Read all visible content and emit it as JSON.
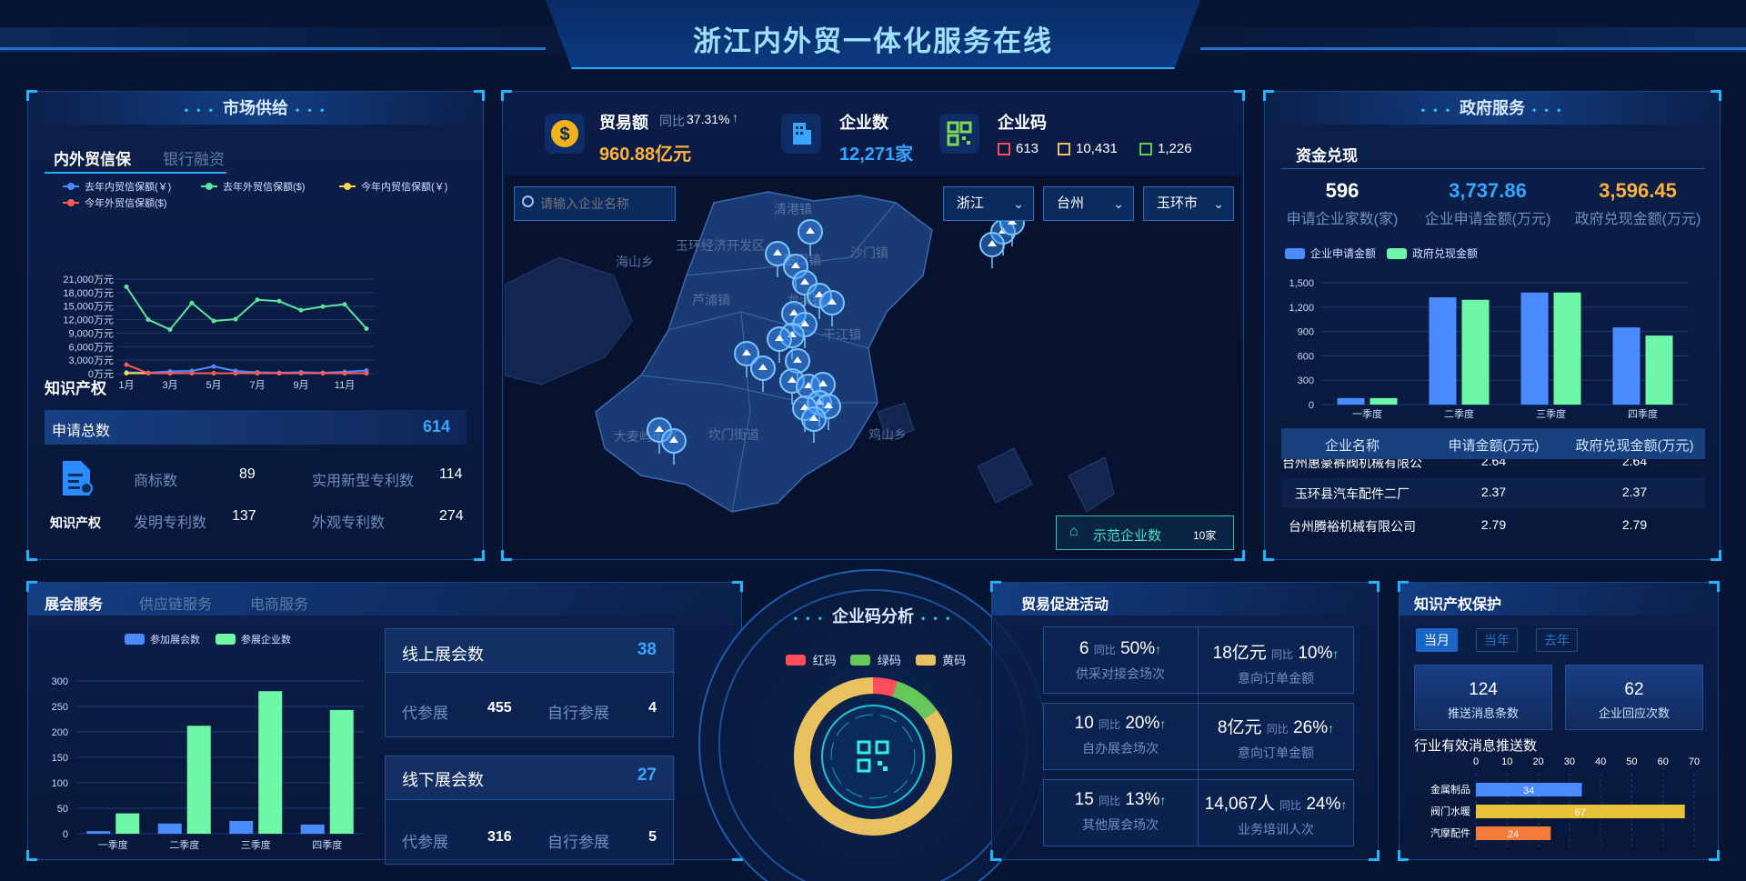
{
  "header": {
    "title": "浙江内外贸一体化服务在线"
  },
  "market": {
    "title": "市场供给",
    "tabs": [
      "内外贸信保",
      "银行融资"
    ],
    "legend": [
      "去年内贸信保额(￥)",
      "去年外贸信保额($)",
      "今年内贸信保额(￥)",
      "今年外贸信保额($)"
    ],
    "legend_colors": [
      "#4a8cff",
      "#5ce39c",
      "#ffd84a",
      "#ff5a5a"
    ],
    "ip_title": "知识产权",
    "apply_total_label": "申请总数",
    "apply_total_value": "614",
    "ip_icon_label": "知识产权",
    "stats": [
      {
        "label": "商标数",
        "value": "89"
      },
      {
        "label": "实用新型专利数",
        "value": "114"
      },
      {
        "label": "发明专利数",
        "value": "137"
      },
      {
        "label": "外观专利数",
        "value": "274"
      }
    ]
  },
  "chart_data": [
    {
      "type": "line",
      "title": "",
      "x": [
        "1月",
        "2月",
        "3月",
        "4月",
        "5月",
        "6月",
        "7月",
        "8月",
        "9月",
        "10月",
        "11月",
        "12月"
      ],
      "x_tick_labels": [
        "1月",
        "3月",
        "5月",
        "7月",
        "9月",
        "11月"
      ],
      "y_tick_labels": [
        "0万元",
        "3,000万元",
        "6,000万元",
        "9,000万元",
        "12,000万元",
        "15,000万元",
        "18,000万元",
        "21,000万元"
      ],
      "ylim": [
        0,
        21000
      ],
      "series": [
        {
          "name": "去年内贸信保额(￥)",
          "color": "#4a8cff",
          "values": [
            300,
            200,
            500,
            600,
            1600,
            600,
            300,
            200,
            300,
            200,
            400,
            700
          ]
        },
        {
          "name": "去年外贸信保额($)",
          "color": "#5ce39c",
          "values": [
            19300,
            12000,
            9800,
            15700,
            11700,
            12100,
            16400,
            16100,
            14100,
            14900,
            15400,
            10000
          ]
        },
        {
          "name": "今年内贸信保额(￥)",
          "color": "#ffd84a",
          "values": [
            100,
            100,
            100,
            100,
            100,
            100,
            100,
            100,
            100,
            100,
            100,
            100
          ]
        },
        {
          "name": "今年外贸信保额($)",
          "color": "#ff5a5a",
          "values": [
            2000,
            100,
            100,
            100,
            100,
            100,
            100,
            100,
            100,
            100,
            100,
            100
          ]
        }
      ]
    },
    {
      "type": "bar",
      "title": "",
      "categories": [
        "一季度",
        "二季度",
        "三季度",
        "四季度"
      ],
      "y_tick_labels": [
        "0",
        "300",
        "600",
        "900",
        "1,200",
        "1,500"
      ],
      "ylim": [
        0,
        1500
      ],
      "series": [
        {
          "name": "企业申请金额",
          "color": "#4a8cff",
          "values": [
            80,
            1320,
            1380,
            950
          ]
        },
        {
          "name": "政府兑现金额",
          "color": "#6df7a6",
          "values": [
            80,
            1290,
            1380,
            850
          ]
        }
      ]
    },
    {
      "type": "bar",
      "title": "",
      "categories": [
        "一季度",
        "二季度",
        "三季度",
        "四季度"
      ],
      "y_tick_labels": [
        "0",
        "50",
        "100",
        "150",
        "200",
        "250",
        "300"
      ],
      "ylim": [
        0,
        300
      ],
      "series": [
        {
          "name": "参加展会数",
          "color": "#4a8cff",
          "values": [
            5,
            20,
            25,
            18
          ]
        },
        {
          "name": "参展企业数",
          "color": "#6df7a6",
          "values": [
            40,
            212,
            280,
            243
          ]
        }
      ]
    },
    {
      "type": "pie",
      "title": "",
      "series": [
        {
          "name": "红码",
          "color": "#ff4d5e",
          "values": [
            613
          ]
        },
        {
          "name": "绿码",
          "color": "#67c85a",
          "values": [
            1226
          ]
        },
        {
          "name": "黄码",
          "color": "#e7c25e",
          "values": [
            10431
          ]
        }
      ]
    },
    {
      "type": "bar",
      "title": "",
      "orientation": "horizontal",
      "categories": [
        "金属制品",
        "阀门水暖",
        "汽摩配件"
      ],
      "x_tick_labels": [
        "0",
        "10",
        "20",
        "30",
        "40",
        "50",
        "60",
        "70"
      ],
      "xlim": [
        0,
        70
      ],
      "values": [
        34,
        67,
        24
      ],
      "colors": [
        "#4a8cff",
        "#e7c236",
        "#f47a3a"
      ]
    }
  ],
  "center": {
    "kpis": [
      {
        "icon": "dollar-icon",
        "label": "贸易额",
        "yoy_label": "同比",
        "yoy": "37.31%",
        "value": "960.88亿元"
      },
      {
        "icon": "building-icon",
        "label": "企业数",
        "value": "12,271家"
      },
      {
        "icon": "qr-icon",
        "label": "企业码",
        "red": "613",
        "yellow": "10,431",
        "green": "1,226"
      }
    ],
    "search_placeholder": "请输入企业名称",
    "selects": [
      "浙江",
      "台州",
      "玉环市"
    ],
    "map_labels": [
      "清港镇",
      "玉环经济开发区",
      "海山乡",
      "楚门镇",
      "沙门镇",
      "芦浦镇",
      "龙溪镇",
      "干江镇",
      "大麦屿街道",
      "坎门街道",
      "鸡山乡"
    ],
    "legend_label": "示范企业数",
    "legend_value": "10家"
  },
  "gov": {
    "title": "政府服务",
    "section": "资金兑现",
    "stats": [
      {
        "value": "596",
        "label": "申请企业家数(家)"
      },
      {
        "value": "3,737.86",
        "label": "企业申请金额(万元)"
      },
      {
        "value": "3,596.45",
        "label": "政府兑现金额(万元)"
      }
    ],
    "legend": [
      "企业申请金额",
      "政府兑现金额"
    ],
    "table_headers": [
      "企业名称",
      "申请金额(万元)",
      "政府兑现金额(万元)"
    ],
    "table_rows": [
      [
        "台州惠豪裤阀机械有限公",
        "2.64",
        "2.64"
      ],
      [
        "玉环县汽车配件二厂",
        "2.37",
        "2.37"
      ],
      [
        "台州腾裕机械有限公司",
        "2.79",
        "2.79"
      ]
    ]
  },
  "exhibit": {
    "tabs": [
      "展会服务",
      "供应链服务",
      "电商服务"
    ],
    "legend": [
      "参加展会数",
      "参展企业数"
    ],
    "online": {
      "label": "线上展会数",
      "value": "38",
      "a_label": "代参展",
      "a_value": "455",
      "b_label": "自行参展",
      "b_value": "4"
    },
    "offline": {
      "label": "线下展会数",
      "value": "27",
      "a_label": "代参展",
      "a_value": "316",
      "b_label": "自行参展",
      "b_value": "5"
    }
  },
  "qr": {
    "title": "企业码分析",
    "legend": [
      "红码",
      "绿码",
      "黄码"
    ]
  },
  "promo": {
    "title": "贸易促进活动",
    "cells": [
      {
        "num": "6",
        "yoy_label": "同比",
        "yoy": "50%",
        "label": "供采对接会场次"
      },
      {
        "num": "18亿元",
        "yoy_label": "同比",
        "yoy": "10%",
        "label": "意向订单金额"
      },
      {
        "num": "10",
        "yoy_label": "同比",
        "yoy": "20%",
        "label": "自办展会场次"
      },
      {
        "num": "8亿元",
        "yoy_label": "同比",
        "yoy": "26%",
        "label": "意向订单金额"
      },
      {
        "num": "15",
        "yoy_label": "同比",
        "yoy": "13%",
        "label": "其他展会场次"
      },
      {
        "num": "14,067人",
        "yoy_label": "同比",
        "yoy": "24%",
        "label": "业务培训人次"
      }
    ]
  },
  "ipp": {
    "title": "知识产权保护",
    "tabs": [
      "当月",
      "当年",
      "去年"
    ],
    "stat1": {
      "value": "124",
      "label": "推送消息条数"
    },
    "stat2": {
      "value": "62",
      "label": "企业回应次数"
    },
    "chart_title": "行业有效消息推送数"
  }
}
